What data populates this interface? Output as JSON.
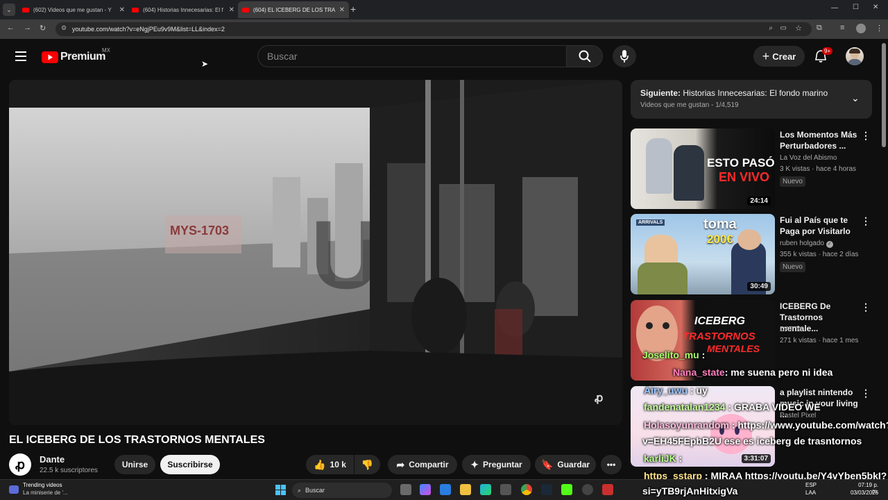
{
  "browser": {
    "tabs": [
      {
        "title": "(602) Videos que me gustan - Y"
      },
      {
        "title": "(604) Historias Innecesarias: El f"
      },
      {
        "title": "(604) EL ICEBERG DE LOS TRAST"
      }
    ],
    "url": "youtube.com/watch?v=eNgjPEu9v9M&list=LL&index=2",
    "new_tab": "+",
    "controls": {
      "minimize": "—",
      "maximize": "☐",
      "close": "✕"
    }
  },
  "header": {
    "logo_text": "Premium",
    "region": "MX",
    "search_placeholder": "Buscar",
    "create_label": "Crear",
    "notifications_badge": "9+"
  },
  "video": {
    "title": "EL ICEBERG DE LOS TRASTORNOS MENTALES",
    "channel": "Dante",
    "subscribers": "22.5 k suscriptores",
    "join_label": "Unirse",
    "subscribe_label": "Suscribirse",
    "likes": "10 k",
    "share_label": "Compartir",
    "ask_label": "Preguntar",
    "save_label": "Guardar"
  },
  "playlist": {
    "next_prefix": "Siguiente:",
    "next_title": "Historias Innecesarias: El fondo marino",
    "subtitle": "Videos que me gustan - 1/4,519"
  },
  "recommendations": [
    {
      "title": "Los Momentos Más Perturbadores ...",
      "channel": "La Voz del Abismo",
      "meta": "3 K vistas · hace 4 horas",
      "badge": "Nuevo",
      "duration": "24:14",
      "thumb_text": [
        "ESTO PASÓ",
        "EN VIVO"
      ]
    },
    {
      "title": "Fui al País que te Paga por Visitarlo",
      "channel": "ruben holgado",
      "meta": "355 k vistas · hace 2 días",
      "badge": "Nuevo",
      "duration": "30:49",
      "thumb_text": [
        "toma",
        "200€",
        "ARRIVALS"
      ]
    },
    {
      "title": "ICEBERG De Trastornos mentale...",
      "channel": "DATTA",
      "meta": "271 k vistas · hace 1 mes",
      "badge": "",
      "duration": "",
      "thumb_text": [
        "ICEBERG",
        "TRASTORNOS",
        "MENTALES"
      ]
    },
    {
      "title": "a playlist nintendo music in your living ...",
      "channel": "Pastel Pixel",
      "meta": "",
      "badge": "",
      "duration": "3:31:07",
      "thumb_text": []
    }
  ],
  "chat_overlay": [
    {
      "user": "Joselito_mu",
      "text": ":"
    },
    {
      "user": "Nana_state",
      "text": ": me suena pero ni idea"
    },
    {
      "user": "Airy_uwu",
      "text": ": uy"
    },
    {
      "user": "fandenatalan1234",
      "text": ": GRABA VIDEO WE"
    },
    {
      "user": "Holasoyunrandom",
      "text": ": https://www.youtube.com/watch?"
    },
    {
      "user": "",
      "text": "v=EH45FEpbB2U ese es iceberg de trasntornos"
    },
    {
      "user": "karliJK",
      "text": ":"
    },
    {
      "user": "https_sstarp",
      "text": ": MIRAA https://youtu.be/Y4vYben5bkI?"
    },
    {
      "user": "",
      "text": "si=yTB9rjAnHitxigVa"
    }
  ],
  "taskbar": {
    "widget_title": "Trending videos",
    "widget_sub": "La miniserie de '...",
    "search_label": "Buscar",
    "lang": "ESP",
    "lang_sub": "LAA",
    "time": "07:19 p. m.",
    "date": "03/03/2026"
  },
  "colors": {
    "accent": "#ff0000",
    "background": "#0f0f0f",
    "chat_user": "#ffbfe0"
  }
}
